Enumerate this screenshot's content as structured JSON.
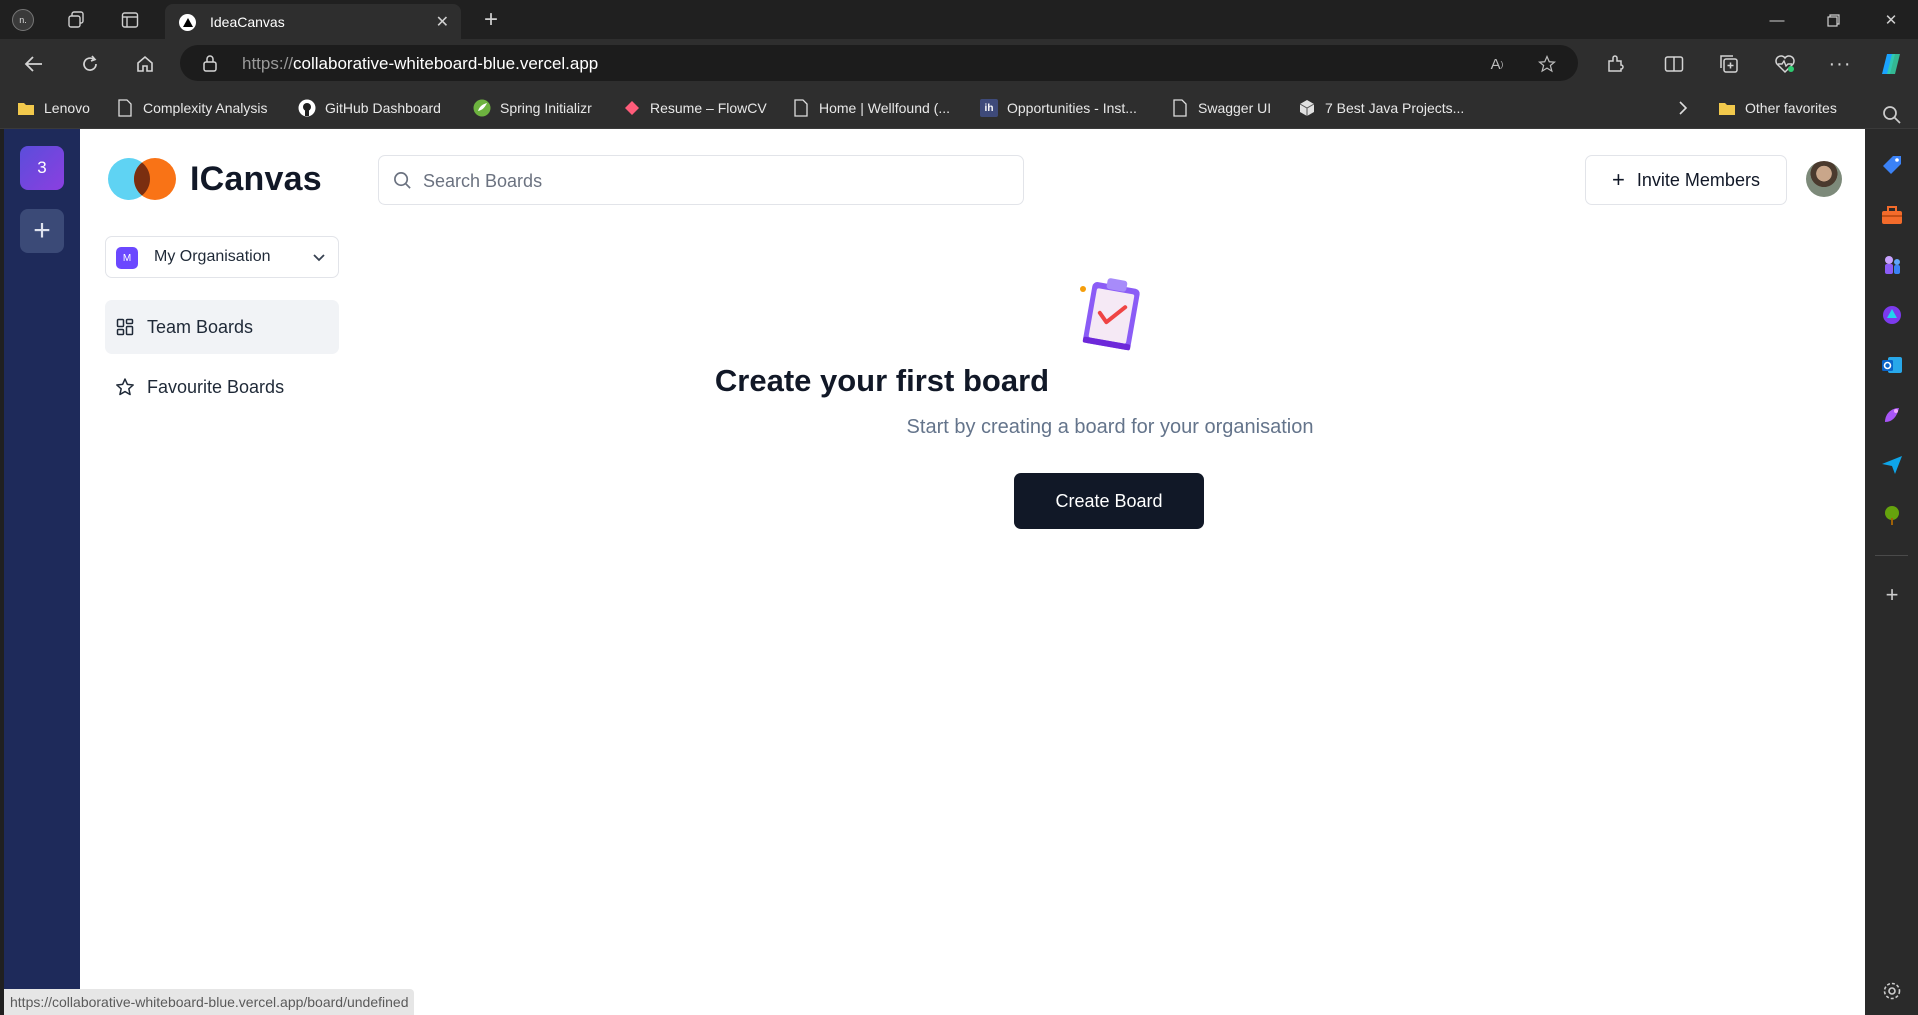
{
  "browser": {
    "tab_title": "IdeaCanvas",
    "url_protocol": "https://",
    "url_host": "collaborative-whiteboard-blue.vercel.app",
    "status_url": "https://collaborative-whiteboard-blue.vercel.app/board/undefined",
    "favorites": [
      {
        "label": "Lenovo",
        "icon": "folder-icon"
      },
      {
        "label": "Complexity Analysis",
        "icon": "page-icon"
      },
      {
        "label": "GitHub Dashboard",
        "icon": "github-icon"
      },
      {
        "label": "Spring Initializr",
        "icon": "spring-icon"
      },
      {
        "label": "Resume – FlowCV",
        "icon": "flowcv-icon"
      },
      {
        "label": "Home | Wellfound (...",
        "icon": "page-icon"
      },
      {
        "label": "Opportunities - Inst...",
        "icon": "ih-icon"
      },
      {
        "label": "Swagger UI",
        "icon": "page-icon"
      },
      {
        "label": "7 Best Java Projects...",
        "icon": "cube-icon"
      }
    ],
    "other_favorites": "Other favorites"
  },
  "org_rail": {
    "badge": "3",
    "add": "+"
  },
  "sidebar": {
    "logo_text": "ICanvas",
    "org_initial": "M",
    "org_name": "My Organisation",
    "items": [
      {
        "label": "Team Boards",
        "icon": "dashboard-icon",
        "active": true
      },
      {
        "label": "Favourite Boards",
        "icon": "star-icon",
        "active": false
      }
    ]
  },
  "header": {
    "search_placeholder": "Search Boards",
    "invite_label": "Invite Members"
  },
  "empty_state": {
    "title": "Create your first board",
    "subtitle": "Start by creating a board for your organisation",
    "button": "Create Board"
  },
  "colors": {
    "rail": "#1e2a5a",
    "primary_button": "#111827",
    "accent_purple": "#6b48ff",
    "logo_blue": "#5fd3f3",
    "logo_orange": "#f97316"
  }
}
